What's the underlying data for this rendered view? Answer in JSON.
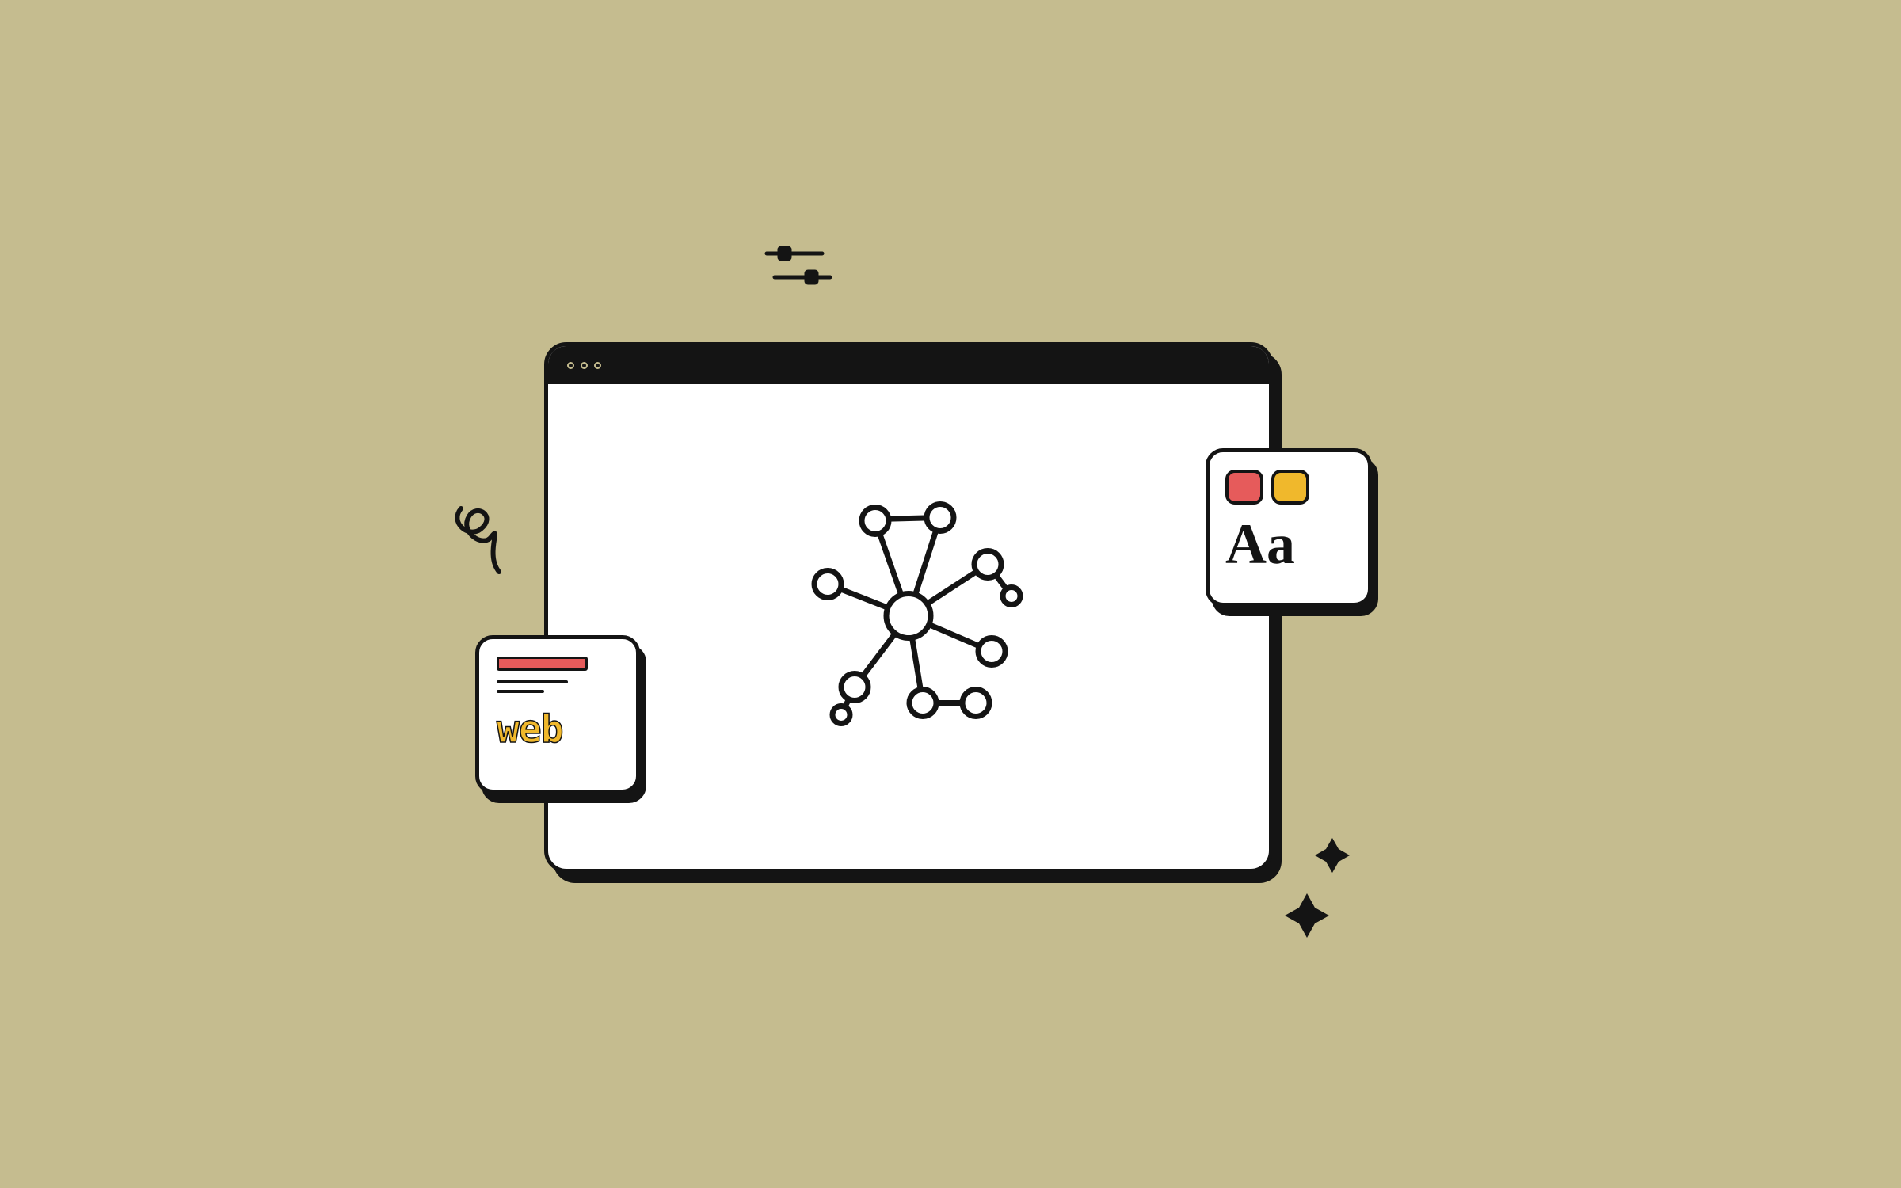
{
  "web_card": {
    "label": "web"
  },
  "aa_card": {
    "label": "Aa"
  },
  "colors": {
    "background": "#c5bc8f",
    "stroke": "#141414",
    "red": "#e65b5b",
    "yellow": "#f0b82c"
  }
}
